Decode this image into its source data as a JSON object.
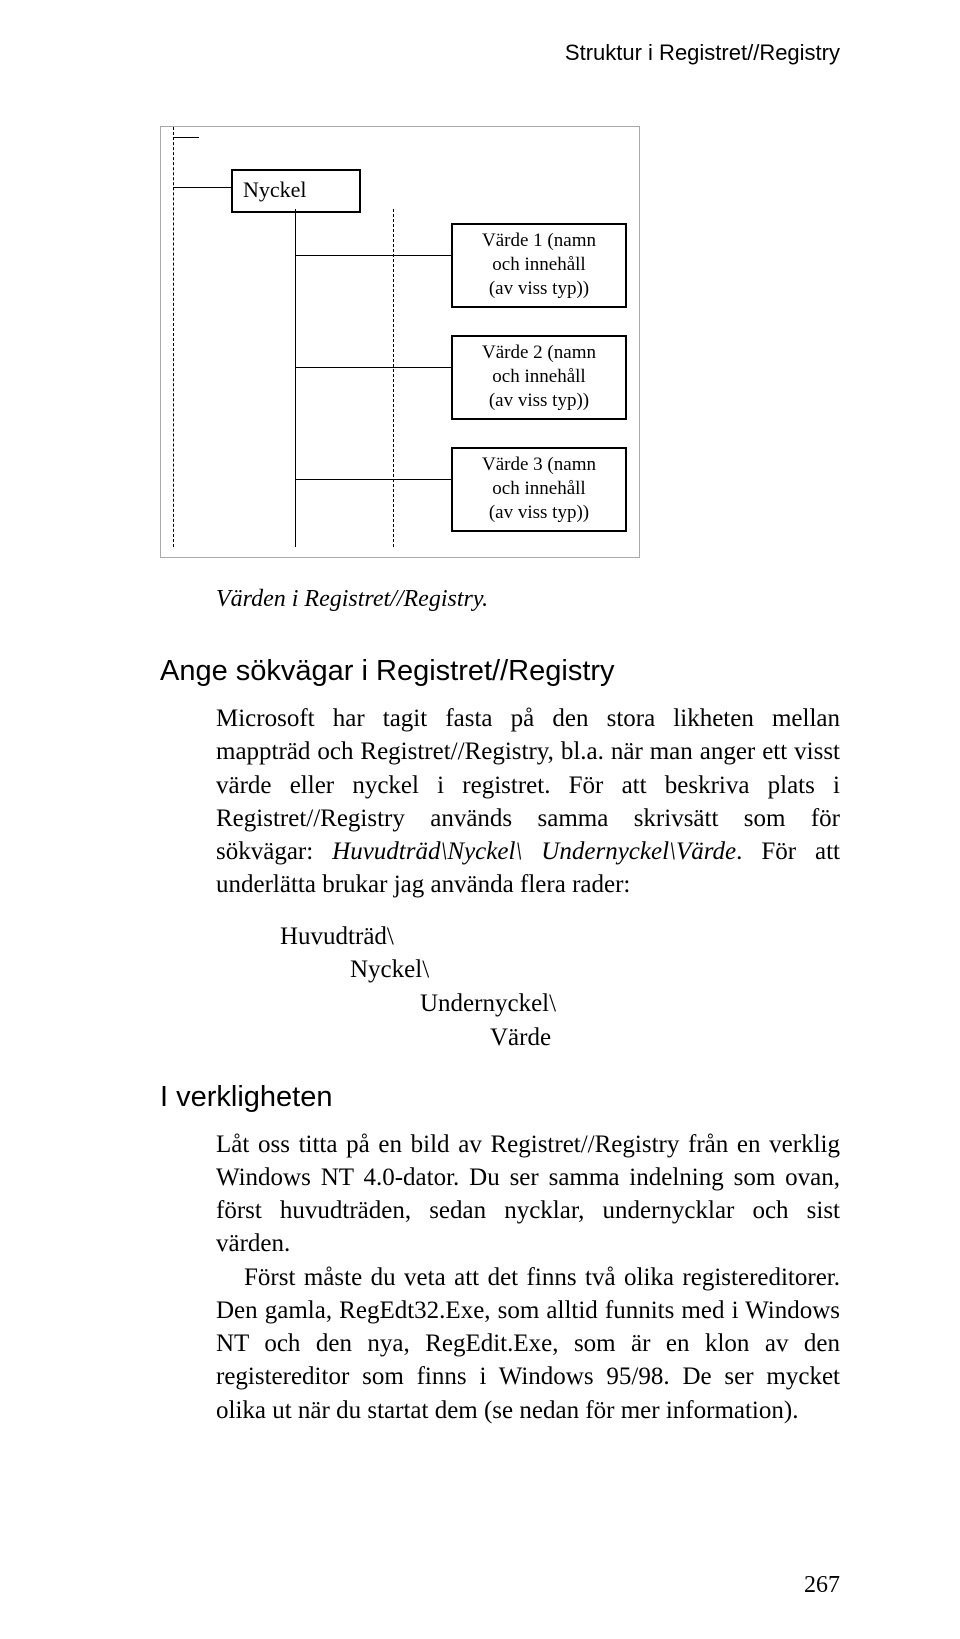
{
  "running_header": "Struktur i Registret//Registry",
  "figure": {
    "key_label": "Nyckel",
    "values": [
      {
        "line1": "Värde 1 (namn",
        "line2": "och innehåll",
        "line3": "(av viss typ))"
      },
      {
        "line1": "Värde 2 (namn",
        "line2": "och innehåll",
        "line3": "(av viss typ))"
      },
      {
        "line1": "Värde 3 (namn",
        "line2": "och innehåll",
        "line3": "(av viss typ))"
      }
    ]
  },
  "caption": "Värden i Registret//Registry.",
  "section1": {
    "heading": "Ange sökvägar i Registret//Registry",
    "p1a": "Microsoft har tagit fasta på den stora likheten mellan mappträd och Registret//Registry, bl.a. när man anger ett visst värde eller nyckel i registret. För att beskriva plats i Registret//Registry används samma skrivsätt som för sökvägar: ",
    "p1_em": "Huvudträd\\Nyckel\\ Undernyckel\\Värde",
    "p1b": ". För att underlätta brukar jag använda flera rader:"
  },
  "tree": {
    "l1": "Huvudträd\\",
    "l2": "Nyckel\\",
    "l3": "Undernyckel\\",
    "l4": "Värde"
  },
  "section2": {
    "heading": "I verkligheten",
    "p1": "Låt oss titta på en bild av Registret//Registry från en verklig Windows NT 4.0-dator. Du ser samma indelning som ovan, först huvudträden, sedan nycklar, undernycklar och sist värden.",
    "p2": "Först måste du veta att det finns två olika registereditorer. Den gamla, RegEdt32.Exe, som alltid funnits med i Windows NT och den nya, RegEdit.Exe, som är en klon av den registereditor som finns i Windows 95/98. De ser mycket olika ut när du startat dem (se nedan för mer information)."
  },
  "page_number": "267"
}
